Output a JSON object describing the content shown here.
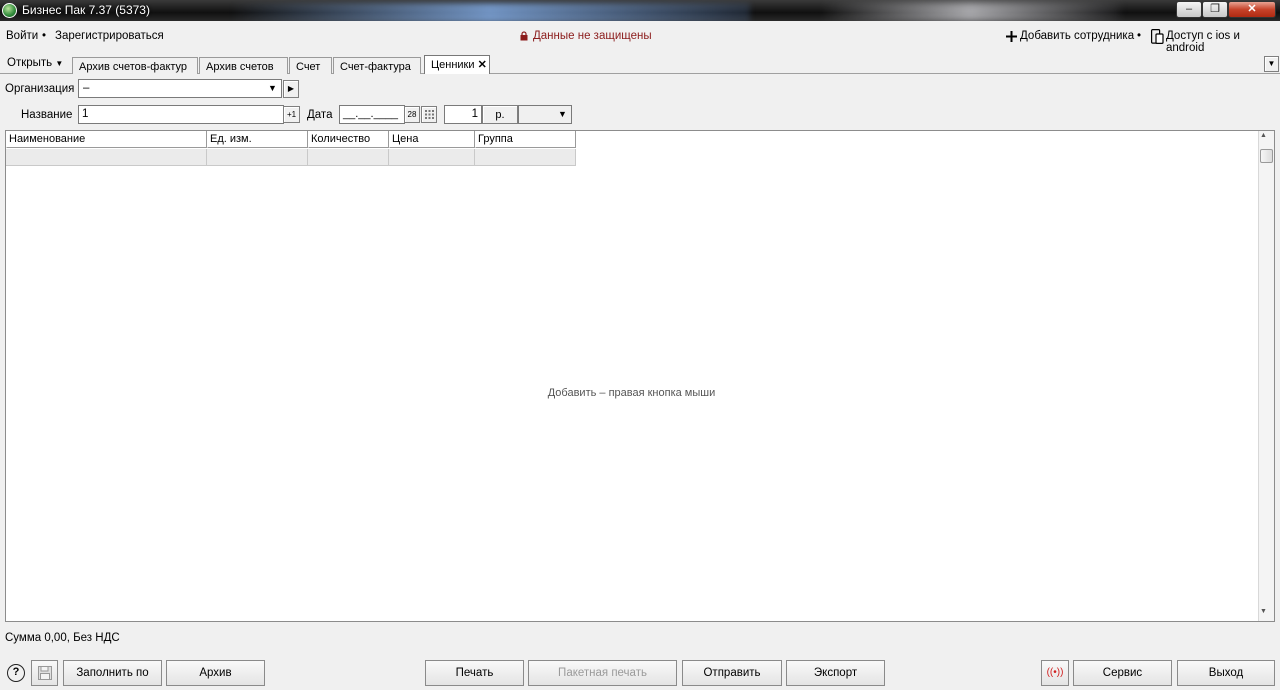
{
  "window": {
    "title": "Бизнес Пак 7.37 (5373)",
    "minimize": "‒",
    "maximize": "❐",
    "close": "✕"
  },
  "topbar": {
    "login": "Войти",
    "register": "Зарегистрироваться",
    "separator": "•",
    "security_warning": "Данные не защищены",
    "add_employee": "Добавить сотрудника",
    "mobile_access": "Доступ с ios и android"
  },
  "tabs": {
    "open_menu": "Открыть",
    "items": [
      "Архив счетов-фактур",
      "Архив счетов",
      "Счет",
      "Счет-фактура",
      "Ценники"
    ],
    "active": "Ценники"
  },
  "form": {
    "organization_label": "Организация",
    "organization_value": "–",
    "name_label": "Название",
    "name_value": "1",
    "increment_label": "+1",
    "date_label": "Дата",
    "date_value": "__.__.____",
    "calendar_label": "28",
    "copies_value": "1",
    "currency_label": "р."
  },
  "table": {
    "columns": [
      "Наименование",
      "Ед. изм.",
      "Количество",
      "Цена",
      "Группа"
    ],
    "empty_hint": "Добавить – правая кнопка мыши"
  },
  "status": {
    "sum_text": "Сумма 0,00, Без НДС"
  },
  "bottom": {
    "help": "?",
    "fill_by": "Заполнить по",
    "archive": "Архив",
    "print": "Печать",
    "batch_print": "Пакетная печать",
    "send": "Отправить",
    "export": "Экспорт",
    "broadcast": "((•))",
    "service": "Сервис",
    "exit": "Выход"
  },
  "colors": {
    "warning": "#8b1c1c",
    "broadcast": "#d02020",
    "active_tab": "#ffffff"
  }
}
